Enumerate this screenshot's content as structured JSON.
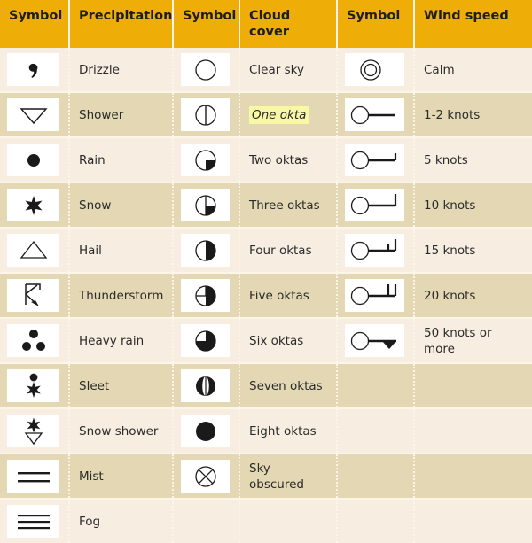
{
  "table": {
    "headers": [
      {
        "label": "Symbol"
      },
      {
        "label": "Precipitation"
      },
      {
        "label": "Symbol"
      },
      {
        "label": "Cloud cover"
      },
      {
        "label": "Symbol"
      },
      {
        "label": "Wind speed"
      }
    ],
    "colors": {
      "header_background": "#efae07",
      "row_light": "#f7ede1",
      "row_dark": "#e3d8b3",
      "symbol_cell_background": "#ffffff",
      "grid_line": "#fdf6e8",
      "highlight": "#f9f9a5",
      "text": "#2b2b2b",
      "symbol_stroke": "#1a1a1a"
    },
    "rows": [
      {
        "precipitation_icon": "drizzle-comma-symbol",
        "precipitation": "Drizzle",
        "cloud_icon": "clear-sky-empty-circle-symbol",
        "cloud": "Clear sky",
        "cloud_highlighted": false,
        "wind_icon": "calm-double-circle-symbol",
        "wind": "Calm"
      },
      {
        "precipitation_icon": "shower-open-triangle-symbol",
        "precipitation": "Shower",
        "cloud_icon": "one-okta-vertical-line-circle-symbol",
        "cloud": "One okta",
        "cloud_highlighted": true,
        "wind_icon": "wind-barb-plain-shaft-symbol",
        "wind": "1-2 knots"
      },
      {
        "precipitation_icon": "rain-filled-dot-symbol",
        "precipitation": "Rain",
        "cloud_icon": "two-oktas-quarter-filled-circle-symbol",
        "cloud": "Two oktas",
        "cloud_highlighted": false,
        "wind_icon": "wind-barb-half-barb-symbol",
        "wind": "5 knots"
      },
      {
        "precipitation_icon": "snow-six-point-star-symbol",
        "precipitation": "Snow",
        "cloud_icon": "three-oktas-circle-symbol",
        "cloud": "Three oktas",
        "cloud_highlighted": false,
        "wind_icon": "wind-barb-one-full-barb-symbol",
        "wind": "10 knots"
      },
      {
        "precipitation_icon": "hail-open-triangle-up-symbol",
        "precipitation": "Hail",
        "cloud_icon": "four-oktas-half-filled-circle-symbol",
        "cloud": "Four oktas",
        "cloud_highlighted": false,
        "wind_icon": "wind-barb-full-and-half-barb-symbol",
        "wind": "15 knots"
      },
      {
        "precipitation_icon": "thunderstorm-k-arrow-symbol",
        "precipitation": "Thunderstorm",
        "cloud_icon": "five-oktas-circle-symbol",
        "cloud": "Five oktas",
        "cloud_highlighted": false,
        "wind_icon": "wind-barb-two-full-barbs-symbol",
        "wind": "20 knots"
      },
      {
        "precipitation_icon": "heavy-rain-three-dots-symbol",
        "precipitation": "Heavy rain",
        "cloud_icon": "six-oktas-circle-symbol",
        "cloud": "Six oktas",
        "cloud_highlighted": false,
        "wind_icon": "wind-barb-pennant-symbol",
        "wind": "50 knots or more"
      },
      {
        "precipitation_icon": "sleet-dot-over-star-symbol",
        "precipitation": "Sleet",
        "cloud_icon": "seven-oktas-circle-symbol",
        "cloud": "Seven oktas",
        "cloud_highlighted": false,
        "wind_icon": "",
        "wind": ""
      },
      {
        "precipitation_icon": "snow-shower-star-over-triangle-symbol",
        "precipitation": "Snow shower",
        "cloud_icon": "eight-oktas-filled-circle-symbol",
        "cloud": "Eight oktas",
        "cloud_highlighted": false,
        "wind_icon": "",
        "wind": ""
      },
      {
        "precipitation_icon": "mist-two-lines-symbol",
        "precipitation": "Mist",
        "cloud_icon": "sky-obscured-crossed-circle-symbol",
        "cloud": "Sky obscured",
        "cloud_highlighted": false,
        "wind_icon": "",
        "wind": ""
      },
      {
        "precipitation_icon": "fog-three-lines-symbol",
        "precipitation": "Fog",
        "cloud_icon": "",
        "cloud": "",
        "cloud_highlighted": false,
        "wind_icon": "",
        "wind": ""
      }
    ]
  }
}
